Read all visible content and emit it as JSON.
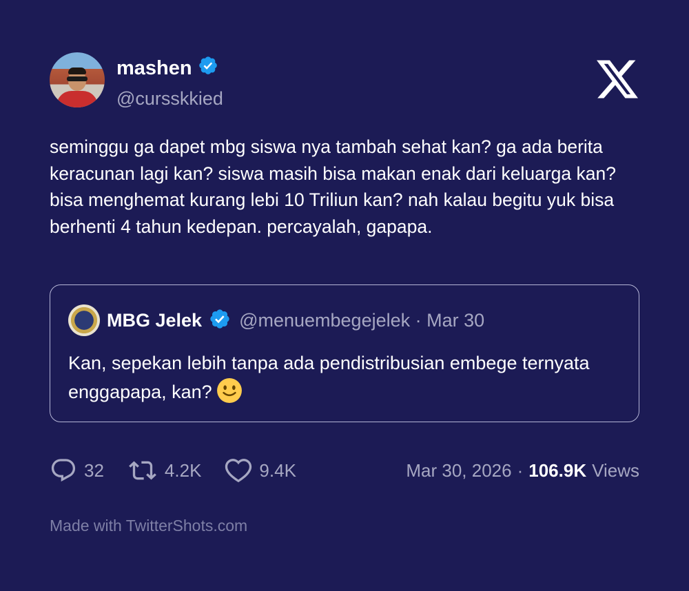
{
  "author": {
    "name": "mashen",
    "handle": "@cursskkied",
    "verified": true
  },
  "brand_icon": "x-logo-icon",
  "tweet": {
    "text": "seminggu ga dapet mbg siswa nya tambah sehat kan? ga ada berita keracunan lagi kan? siswa masih bisa makan enak dari keluarga kan? bisa menghemat kurang lebi 10 Triliun kan? nah kalau begitu yuk bisa berhenti 4 tahun kedepan. percayalah, gapapa."
  },
  "quoted": {
    "name": "MBG Jelek",
    "handle": "@menuembegejelek",
    "separator": "·",
    "date": "Mar 30",
    "text": "Kan, sepekan lebih tanpa ada pendistribusian embege ternyata enggapapa, kan?",
    "emoji_icon": "slightly-smiling-face-icon"
  },
  "metrics": {
    "replies": "32",
    "retweets": "4.2K",
    "likes": "9.4K"
  },
  "stats": {
    "date": "Mar 30, 2026",
    "separator": "·",
    "views_count": "106.9K",
    "views_label": "Views"
  },
  "footer": "Made with TwitterShots.com",
  "colors": {
    "background": "#1c1b55",
    "verified_badge": "#1d9bf0",
    "muted_text": "#a6a7c2",
    "border": "#b5b6d6"
  }
}
